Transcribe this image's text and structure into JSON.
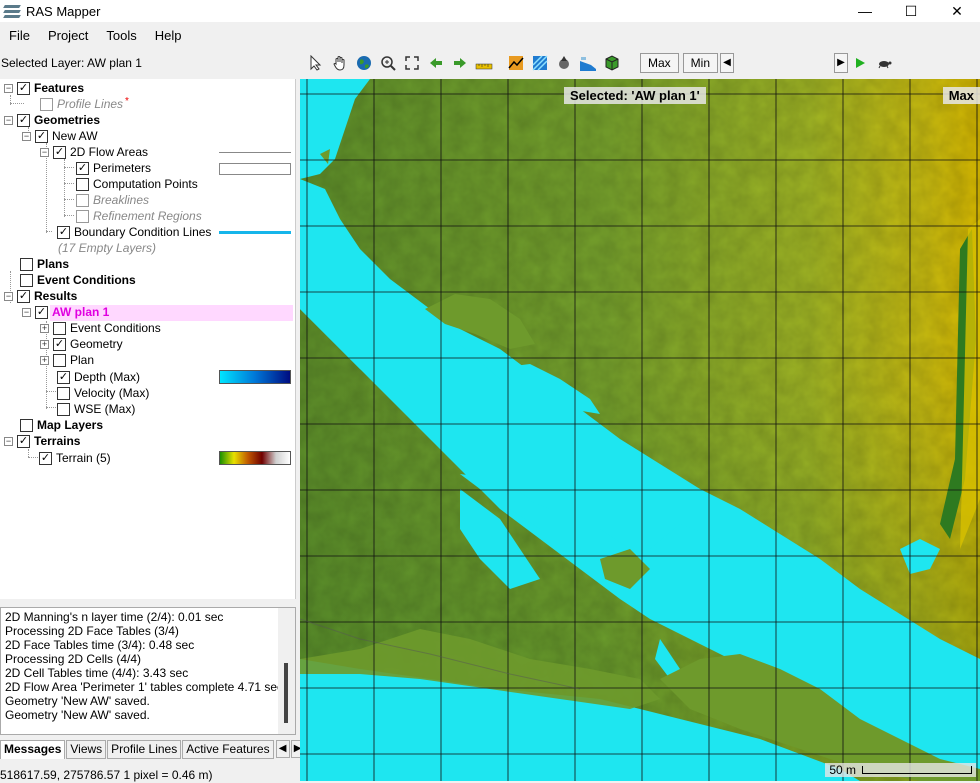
{
  "window": {
    "title": "RAS Mapper",
    "controls": [
      "—",
      "☐",
      "✕"
    ]
  },
  "menu": [
    "File",
    "Project",
    "Tools",
    "Help"
  ],
  "selected_layer": "Selected Layer: AW plan 1",
  "toolbar": {
    "icons": [
      "pointer-icon",
      "pan-hand-icon",
      "globe-icon",
      "zoom-in-icon",
      "zoom-extent-icon",
      "back-arrow-icon",
      "forward-arrow-icon",
      "measure-icon",
      "profile-icon",
      "layer-icon",
      "tool-icon",
      "flow-icon",
      "export-icon"
    ],
    "max_label": "Max",
    "min_label": "Min",
    "left_arrow": "◀",
    "right_arrow": "▶",
    "play": "▶",
    "turtle": "🐢"
  },
  "tree": {
    "features": "Features",
    "profile_lines": "Profile Lines",
    "geometries": "Geometries",
    "new_aw": "New AW",
    "flow_areas": "2D Flow Areas",
    "perimeters": "Perimeters",
    "computation_points": "Computation Points",
    "breaklines": "Breaklines",
    "refinement_regions": "Refinement Regions",
    "bc_lines": "Boundary Condition Lines",
    "empty_layers": "(17 Empty Layers)",
    "plans": "Plans",
    "event_conditions": "Event Conditions",
    "results": "Results",
    "aw_plan": "AW plan 1",
    "res_event_conditions": "Event Conditions",
    "res_geometry": "Geometry",
    "res_plan": "Plan",
    "depth_max": "Depth (Max)",
    "velocity_max": "Velocity (Max)",
    "wse_max": "WSE (Max)",
    "map_layers": "Map Layers",
    "terrains": "Terrains",
    "terrain": "Terrain (5)"
  },
  "messages": [
    "2D Manning's n layer time (2/4): 0.01 sec",
    "Processing 2D Face Tables (3/4)",
    "2D Face Tables time (3/4): 0.48 sec",
    "Processing 2D Cells (4/4)",
    "2D Cell Tables time (4/4): 3.43 sec",
    "2D Flow Area 'Perimeter 1' tables complete 4.71 sec",
    "Geometry 'New AW' saved.",
    "Geometry 'New AW' saved."
  ],
  "tabs": [
    "Messages",
    "Views",
    "Profile Lines",
    "Active Features"
  ],
  "status": "518617.59, 275786.57  1 pixel = 0.46 m)",
  "map": {
    "selected_badge": "Selected: 'AW plan 1'",
    "max_badge": "Max",
    "scale_label": "50 m",
    "colors": {
      "terrain_low": "#5e8f2a",
      "terrain_high": "#d9b400",
      "water": "#1ee6f0",
      "grid": "#111111"
    }
  }
}
